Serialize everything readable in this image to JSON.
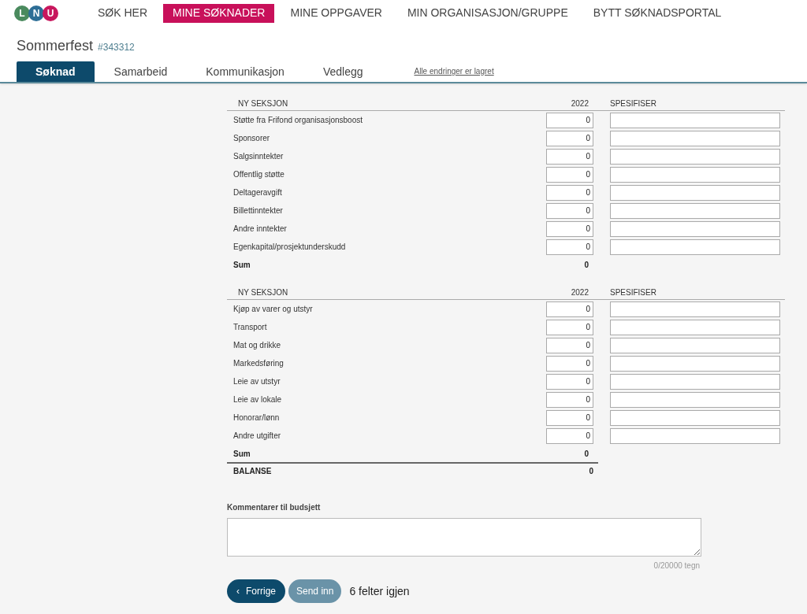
{
  "logo": {
    "letters": [
      "L",
      "N",
      "U"
    ]
  },
  "nav": [
    {
      "label": "SØK HER",
      "selected": false
    },
    {
      "label": "MINE SØKNADER",
      "selected": true
    },
    {
      "label": "MINE OPPGAVER",
      "selected": false
    },
    {
      "label": "MIN ORGANISASJON/GRUPPE",
      "selected": false
    },
    {
      "label": "BYTT SØKNADSPORTAL",
      "selected": false
    }
  ],
  "application": {
    "title": "Sommerfest",
    "number": "#343312"
  },
  "tabs": [
    {
      "label": "Søknad",
      "selected": true
    },
    {
      "label": "Samarbeid",
      "selected": false
    },
    {
      "label": "Kommunikasjon",
      "selected": false
    },
    {
      "label": "Vedlegg",
      "selected": false
    }
  ],
  "save_status": "Alle endringer er lagret",
  "sections": [
    {
      "heading": "NY SEKSJON",
      "year": "2022",
      "spec_heading": "SPESIFISER",
      "sum_label": "Sum",
      "sum_value": "0",
      "rows": [
        {
          "label": "Støtte fra Frifond organisasjonsboost",
          "value": "0"
        },
        {
          "label": "Sponsorer",
          "value": "0"
        },
        {
          "label": "Salgsinntekter",
          "value": "0"
        },
        {
          "label": "Offentlig støtte",
          "value": "0"
        },
        {
          "label": "Deltageravgift",
          "value": "0"
        },
        {
          "label": "Billettinntekter",
          "value": "0"
        },
        {
          "label": "Andre inntekter",
          "value": "0"
        },
        {
          "label": "Egenkapital/prosjektunderskudd",
          "value": "0"
        }
      ]
    },
    {
      "heading": "NY SEKSJON",
      "year": "2022",
      "spec_heading": "SPESIFISER",
      "sum_label": "Sum",
      "sum_value": "0",
      "rows": [
        {
          "label": "Kjøp av varer og utstyr",
          "value": "0"
        },
        {
          "label": "Transport",
          "value": "0"
        },
        {
          "label": "Mat og drikke",
          "value": "0"
        },
        {
          "label": "Markedsføring",
          "value": "0"
        },
        {
          "label": "Leie av utstyr",
          "value": "0"
        },
        {
          "label": "Leie av lokale",
          "value": "0"
        },
        {
          "label": "Honorar/lønn",
          "value": "0"
        },
        {
          "label": "Andre utgifter",
          "value": "0"
        }
      ]
    }
  ],
  "balance": {
    "label": "BALANSE",
    "value": "0"
  },
  "comment": {
    "label": "Kommentarer til budsjett",
    "counter": "0/20000 tegn"
  },
  "buttons": [
    {
      "kind": "back",
      "label": "Forrige",
      "icon": "‹",
      "disabled": false
    },
    {
      "kind": "submit",
      "label": "Send inn",
      "disabled": true
    }
  ],
  "remaining": "6 felter igjen"
}
